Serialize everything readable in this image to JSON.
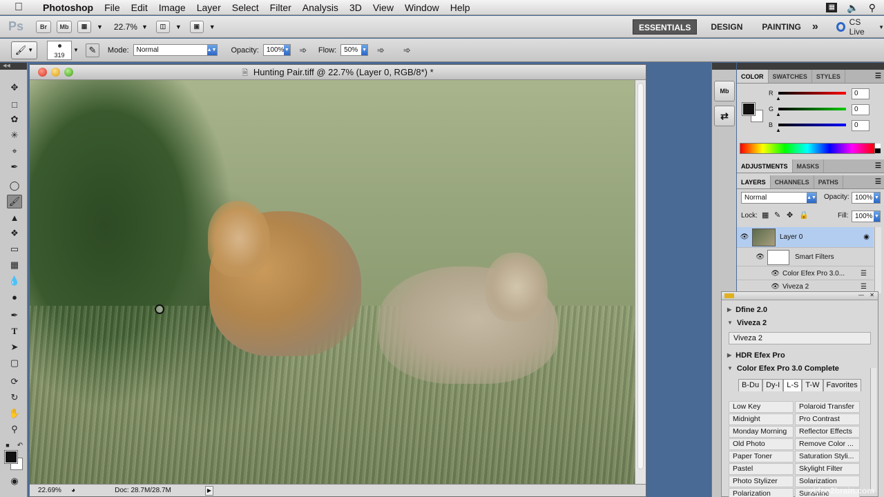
{
  "menubar": {
    "app_name": "Photoshop",
    "items": [
      "File",
      "Edit",
      "Image",
      "Layer",
      "Select",
      "Filter",
      "Analysis",
      "3D",
      "View",
      "Window",
      "Help"
    ]
  },
  "appbar": {
    "ps_logo": "Ps",
    "bridge": "Br",
    "minibridge": "Mb",
    "zoom": "22.7%",
    "workspaces": [
      "ESSENTIALS",
      "DESIGN",
      "PAINTING"
    ],
    "more": "»",
    "cs_live": "CS Live"
  },
  "options": {
    "brush_size": "319",
    "mode_label": "Mode:",
    "mode_value": "Normal",
    "opacity_label": "Opacity:",
    "opacity_value": "100%",
    "flow_label": "Flow:",
    "flow_value": "50%"
  },
  "document": {
    "title": "Hunting Pair.tiff @ 22.7% (Layer 0, RGB/8*) *",
    "status_zoom": "22.69%",
    "status_doc": "Doc: 28.7M/28.7M"
  },
  "collapsed": {
    "mb": "Mb"
  },
  "color_panel": {
    "tabs": [
      "COLOR",
      "SWATCHES",
      "STYLES"
    ],
    "channels": [
      {
        "name": "R",
        "value": "0"
      },
      {
        "name": "G",
        "value": "0"
      },
      {
        "name": "B",
        "value": "0"
      }
    ]
  },
  "adjust_panel": {
    "tabs": [
      "ADJUSTMENTS",
      "MASKS"
    ]
  },
  "layers_panel": {
    "tabs": [
      "LAYERS",
      "CHANNELS",
      "PATHS"
    ],
    "blend_mode": "Normal",
    "opacity_label": "Opacity:",
    "opacity_value": "100%",
    "lock_label": "Lock:",
    "fill_label": "Fill:",
    "fill_value": "100%",
    "layer_name": "Layer 0",
    "smart_filters": "Smart Filters",
    "filters": [
      "Color Efex Pro 3.0...",
      "Viveza 2"
    ]
  },
  "plugin_panel": {
    "sections": {
      "dfine": "Dfine 2.0",
      "viveza": "Viveza 2",
      "viveza_item": "Viveza 2",
      "hdr": "HDR Efex Pro",
      "cef": "Color Efex Pro 3.0 Complete"
    },
    "cef_tabs": [
      "B-Du",
      "Dy-I",
      "L-S",
      "T-W",
      "Favorites"
    ],
    "filters_left": [
      "Low Key",
      "Midnight",
      "Monday Morning",
      "Old Photo",
      "Paper Toner",
      "Pastel",
      "Photo Stylizer",
      "Polarization"
    ],
    "filters_right": [
      "Polaroid Transfer",
      "Pro Contrast",
      "Reflector Effects",
      "Remove Color ...",
      "Saturation Styli...",
      "Skylight Filter",
      "Solarization",
      "Sunshine"
    ]
  },
  "watermark": "video2brain.com",
  "colors": {
    "desktop": "#4a6a96",
    "accent": "#2b67c7",
    "selected_layer": "#b3cdf0"
  }
}
